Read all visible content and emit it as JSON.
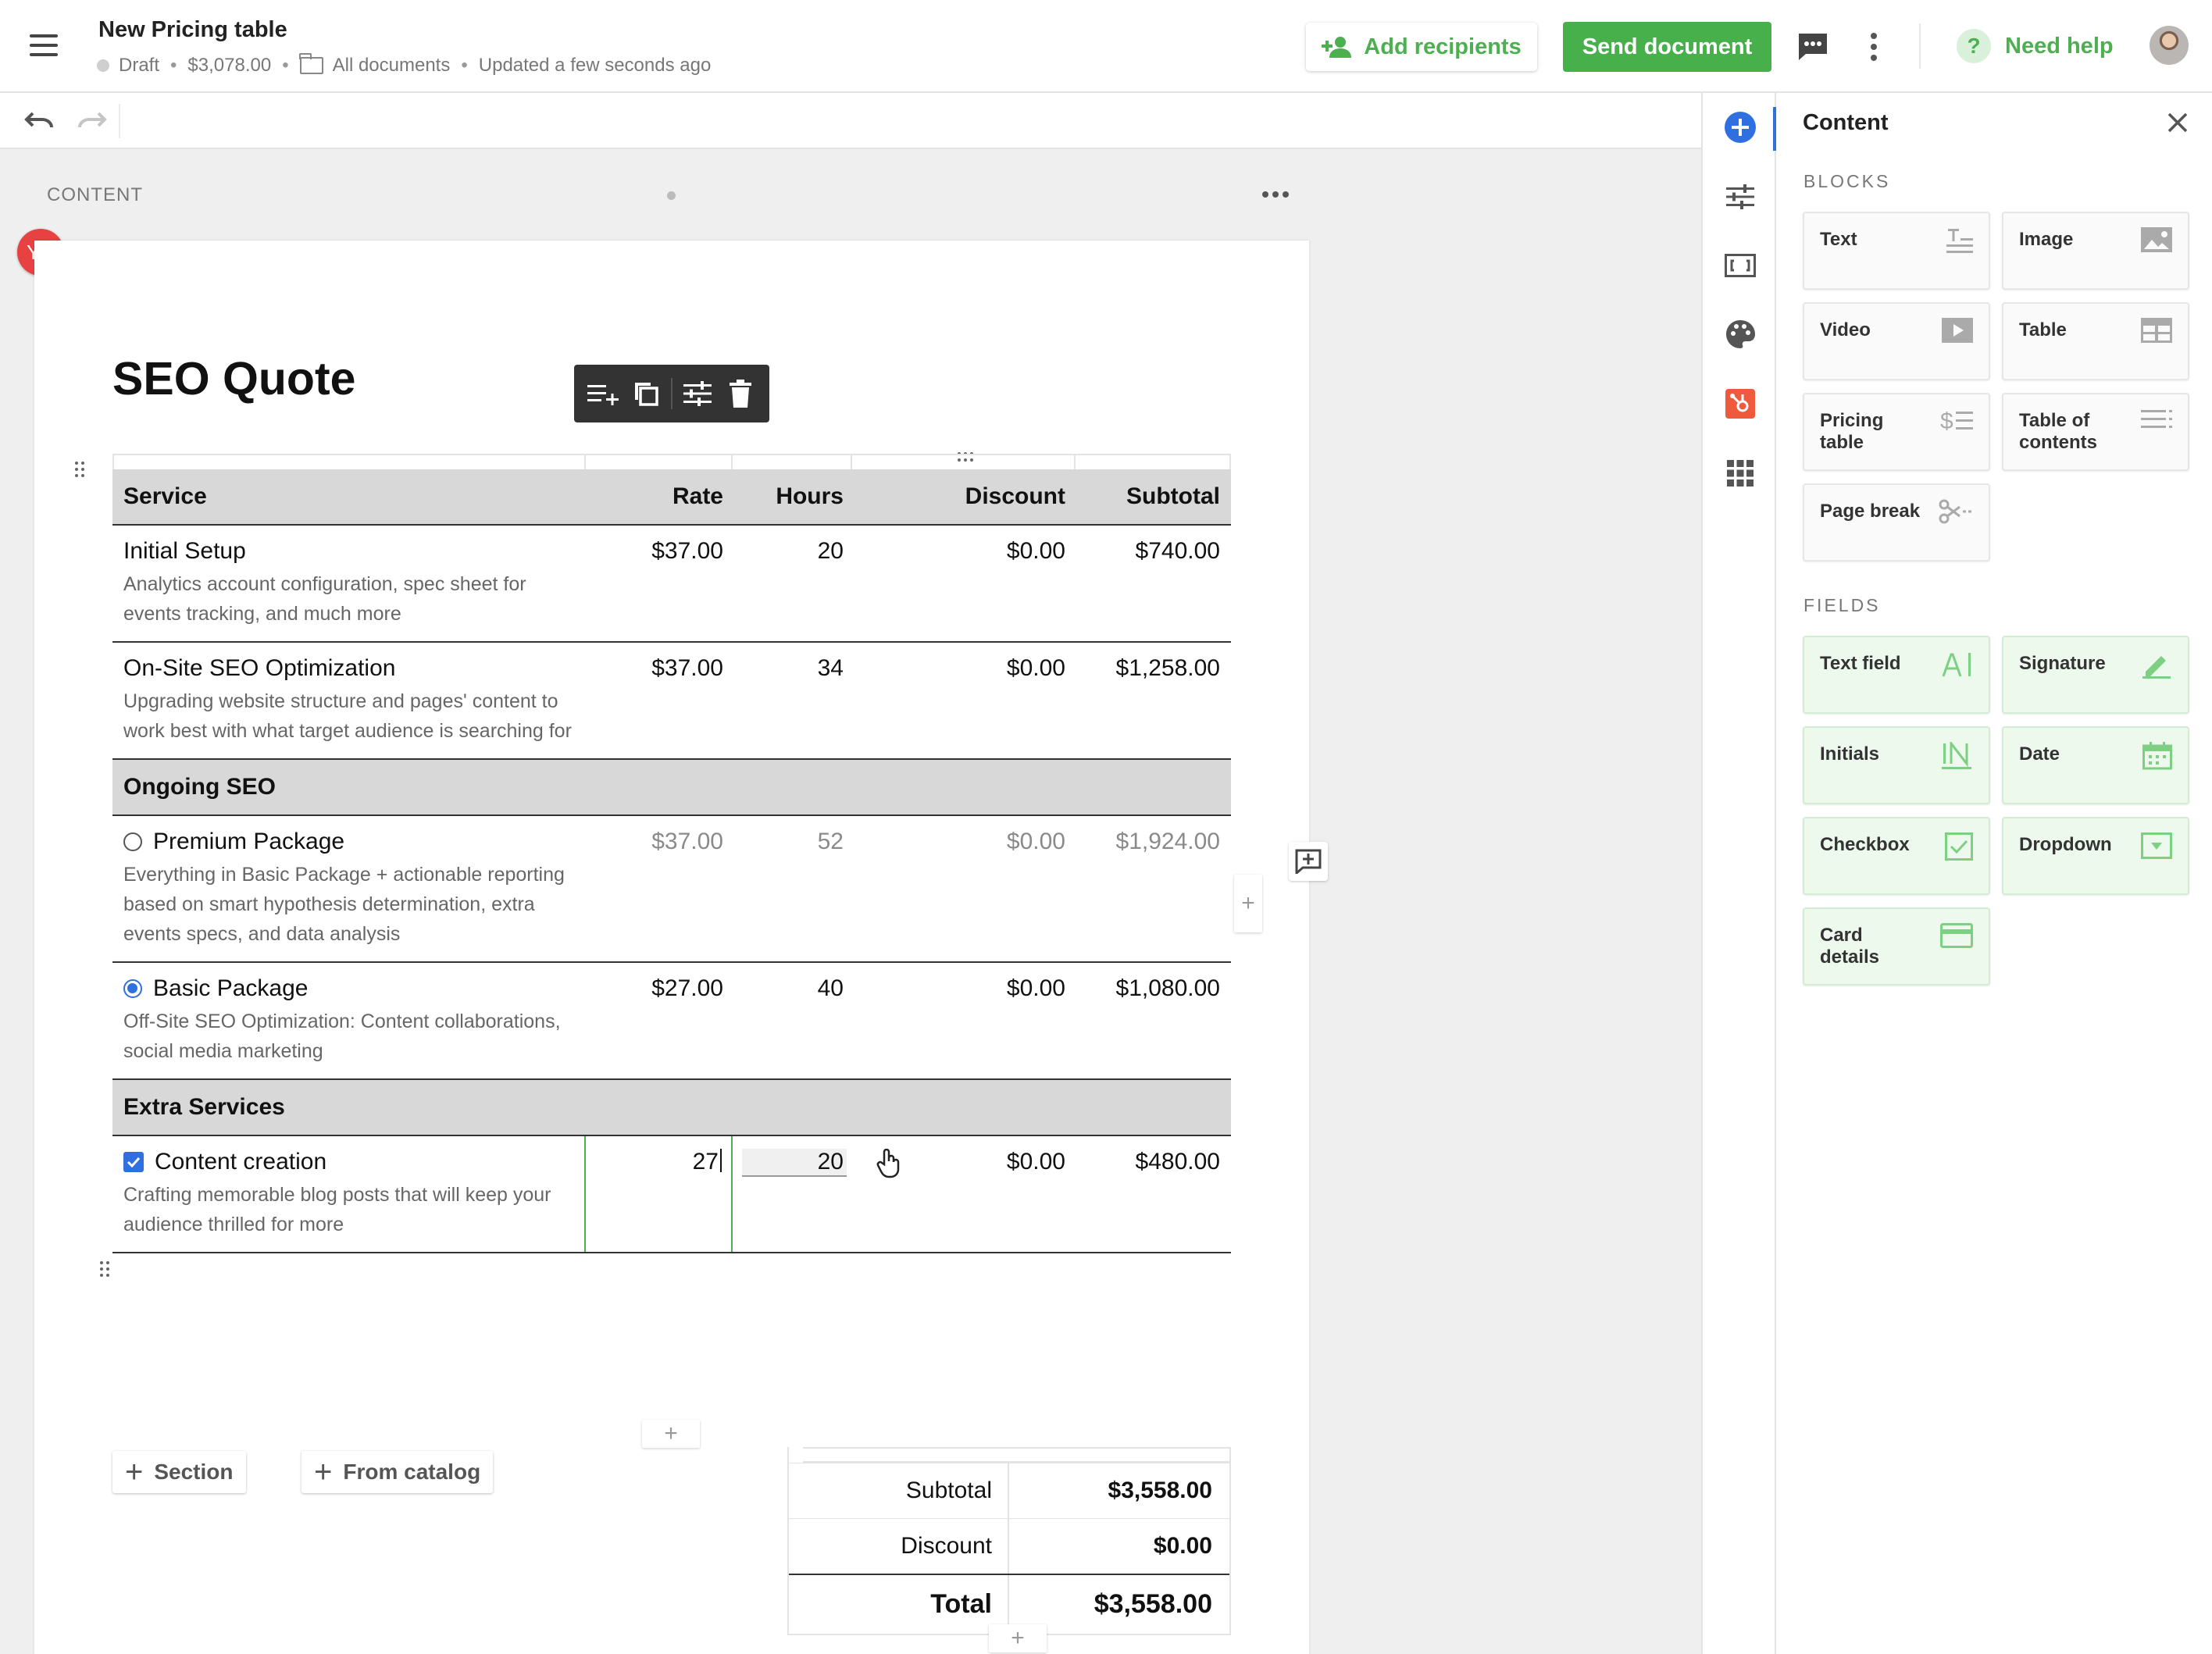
{
  "header": {
    "title": "New Pricing table",
    "status": "Draft",
    "amount": "$3,078.00",
    "folder": "All documents",
    "updated": "Updated a few seconds ago",
    "add_recipients": "Add recipients",
    "send_document": "Send document",
    "need_help": "Need help",
    "help_glyph": "?"
  },
  "canvas": {
    "section_label": "CONTENT",
    "collaborator_initials": "YC"
  },
  "document": {
    "title": "SEO Quote",
    "columns": [
      "Service",
      "Rate",
      "Hours",
      "Discount",
      "Subtotal"
    ],
    "rows": [
      {
        "name": "Initial Setup",
        "desc": "Analytics account configuration, spec sheet for events tracking, and much more",
        "rate": "$37.00",
        "hours": "20",
        "discount": "$0.00",
        "subtotal": "$740.00"
      },
      {
        "name": "On-Site SEO Optimization",
        "desc": "Upgrading website structure and pages' content to work best with what target audience is searching for",
        "rate": "$37.00",
        "hours": "34",
        "discount": "$0.00",
        "subtotal": "$1,258.00"
      }
    ],
    "section_ongoing": "Ongoing SEO",
    "ongoing_rows": [
      {
        "name": "Premium Package",
        "desc": "Everything in Basic Package + actionable reporting based on smart hypothesis determination, extra events specs, and data analysis",
        "rate": "$37.00",
        "hours": "52",
        "discount": "$0.00",
        "subtotal": "$1,924.00",
        "selected": false
      },
      {
        "name": "Basic Package",
        "desc": "Off-Site SEO Optimization: Content collaborations, social media marketing",
        "rate": "$27.00",
        "hours": "40",
        "discount": "$0.00",
        "subtotal": "$1,080.00",
        "selected": true
      }
    ],
    "section_extra": "Extra Services",
    "extra_rows": [
      {
        "name": "Content creation",
        "desc": "Crafting memorable blog posts that will keep your audience thrilled for more",
        "rate": "27",
        "hours": "20",
        "discount": "$0.00",
        "subtotal": "$480.00",
        "checked": true
      }
    ],
    "add_section": "Section",
    "add_from_catalog": "From catalog",
    "add_symbol": "+",
    "summary": {
      "subtotal_label": "Subtotal",
      "subtotal": "$3,558.00",
      "discount_label": "Discount",
      "discount": "$0.00",
      "total_label": "Total",
      "total": "$3,558.00"
    }
  },
  "panel": {
    "title": "Content",
    "blocks_label": "BLOCKS",
    "blocks": [
      "Text",
      "Image",
      "Video",
      "Table",
      "Pricing table",
      "Table of contents",
      "Page break"
    ],
    "fields_label": "FIELDS",
    "fields": [
      "Text field",
      "Signature",
      "Initials",
      "Date",
      "Checkbox",
      "Dropdown",
      "Card details"
    ]
  },
  "colors": {
    "accent_green": "#47b04b",
    "accent_blue": "#2f6fe0",
    "collaborator_red": "#e84141",
    "section_gray": "#d8d8d8"
  },
  "icons": [
    "menu-icon",
    "folder-icon",
    "add-person-icon",
    "chat-icon",
    "more-vertical-icon",
    "help-icon",
    "undo-icon",
    "redo-icon",
    "add-row-icon",
    "duplicate-icon",
    "settings-icon",
    "trash-icon",
    "add-comment-icon",
    "plus-circle-icon",
    "sliders-icon",
    "embed-icon",
    "palette-icon",
    "hubspot-icon",
    "apps-grid-icon",
    "close-icon"
  ]
}
